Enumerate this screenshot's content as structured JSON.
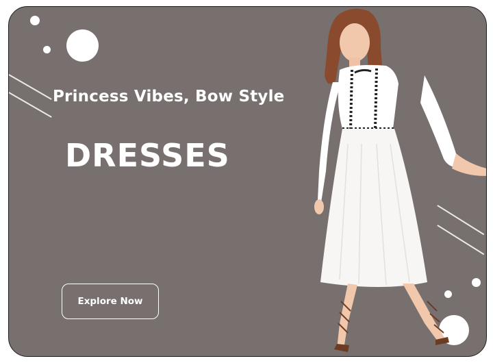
{
  "banner": {
    "subtitle": "Princess Vibes, Bow Style",
    "title": "DRESSES",
    "cta_label": "Explore Now",
    "background_color": "#77706e",
    "image": "girl-in-white-dress-photo"
  }
}
